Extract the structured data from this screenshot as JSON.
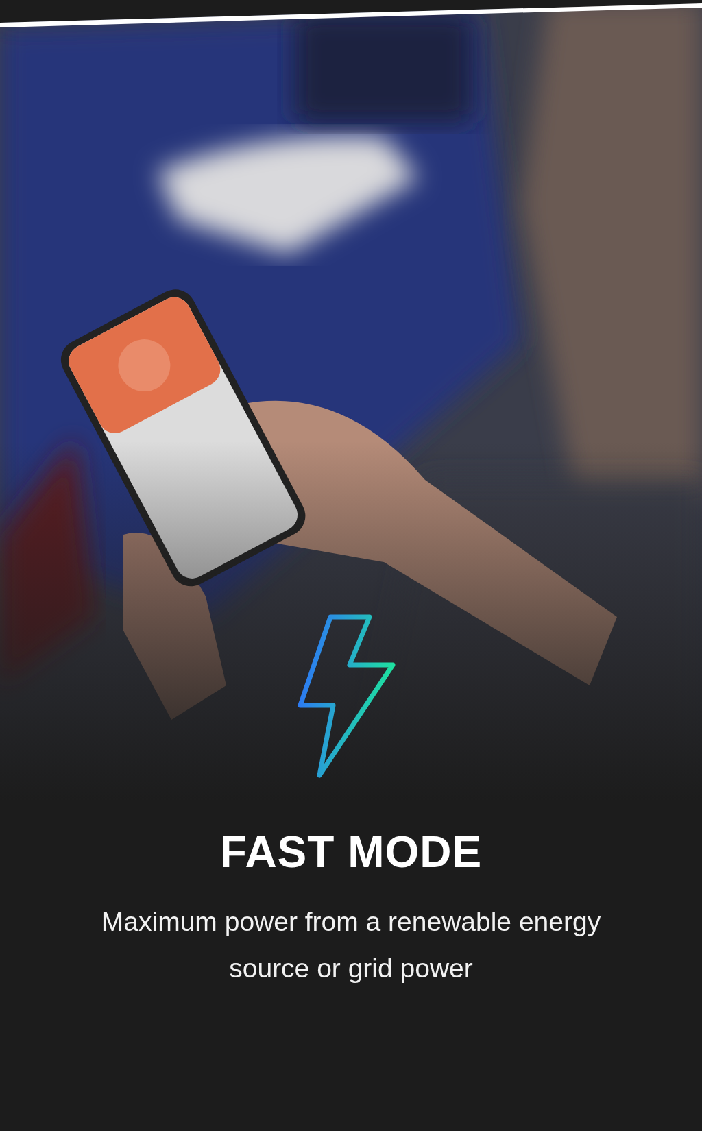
{
  "feature": {
    "title": "FAST MODE",
    "description": "Maximum power from a renewable energy source or grid power"
  }
}
